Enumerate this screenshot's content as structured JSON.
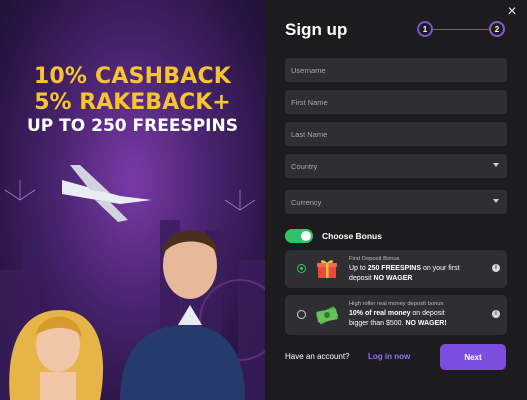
{
  "promo": {
    "line1": "10% CASHBACK",
    "line2": "5% RAKEBACK+",
    "line3": "UP TO 250 FREESPINS"
  },
  "form": {
    "title": "Sign up",
    "steps": [
      "1",
      "2"
    ],
    "close_icon": "✕",
    "fields": {
      "username": "Username",
      "first_name": "First Name",
      "last_name": "Last Name",
      "country": "Country",
      "currency": "Currency"
    },
    "choose_bonus": "Choose Bonus",
    "bonus_enabled": true,
    "bonuses": [
      {
        "small": "First Deposit Bonus",
        "line1_prefix": "Up to ",
        "line1_bold": "250 FREESPINS",
        "line1_suffix": " on your first",
        "line2_prefix": "deposit ",
        "line2_bold": "NO WAGER",
        "selected": true,
        "icon": "gift-icon"
      },
      {
        "small": "High roller real money deposit bonus",
        "line1_bold": "10% of real money",
        "line1_suffix": " on deposit",
        "line2_prefix": "bigger than $500. ",
        "line2_bold": "NO WAGER!",
        "selected": false,
        "icon": "money-icon"
      }
    ],
    "have_account": "Have an account?",
    "login": "Log in now",
    "next": "Next"
  },
  "colors": {
    "accent": "#7b4fe0",
    "toggle": "#2ec36b",
    "promo_yellow": "#f7c531"
  }
}
